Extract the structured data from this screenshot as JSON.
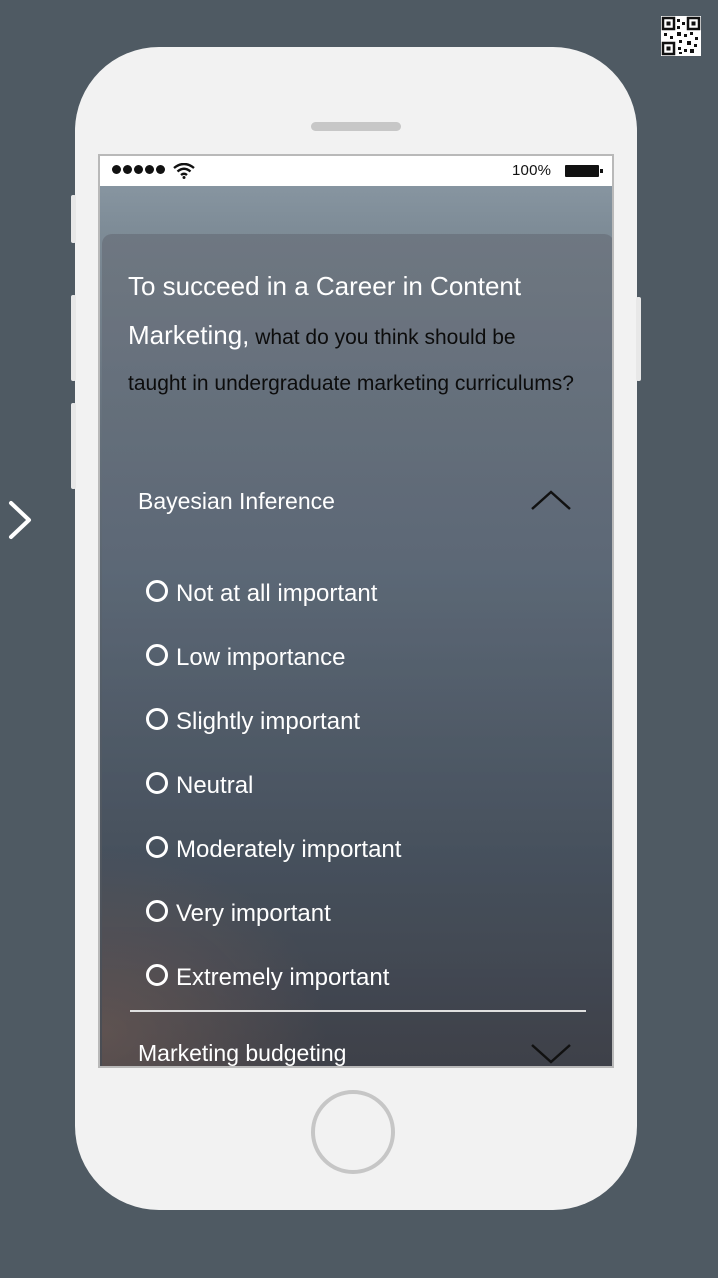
{
  "status_bar": {
    "signal_icon": "signal-dots-icon",
    "wifi_icon": "wifi-icon",
    "battery_percent": "100%",
    "battery_icon": "battery-icon"
  },
  "nav": {
    "next_icon": "chevron-right-icon"
  },
  "qr_icon": "qr-code-icon",
  "survey": {
    "question_strong": "To succeed in a Career in Content Marketing,",
    "question_rest": " what do you think should be taught in undergraduate marketing curriculums?",
    "sections": [
      {
        "title": "Bayesian Inference",
        "expanded": true,
        "toggle_icon": "chevron-up-icon",
        "options": [
          "Not at all important",
          "Low importance",
          "Slightly important",
          "Neutral",
          "Moderately important",
          "Very important",
          "Extremely important"
        ]
      },
      {
        "title": "Marketing budgeting",
        "expanded": false,
        "toggle_icon": "chevron-down-icon"
      }
    ]
  },
  "colors": {
    "page_background": "#4f5a63",
    "phone_body": "#f2f2f2",
    "text_light": "#ffffff",
    "text_dark": "#0c0c0c"
  }
}
